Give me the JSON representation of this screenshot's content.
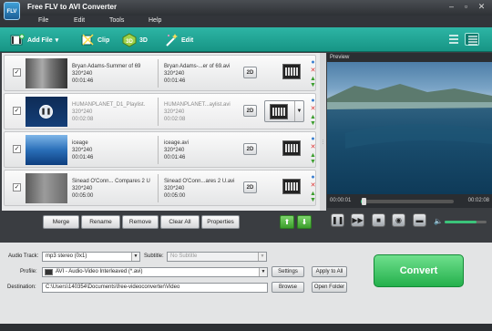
{
  "app": {
    "title": "Free FLV to AVI Converter",
    "logo_text": "FLV"
  },
  "menu": [
    "File",
    "Edit",
    "Tools",
    "Help"
  ],
  "toolbar": {
    "add_file": "Add File",
    "clip": "Clip",
    "3d": "3D",
    "edit": "Edit"
  },
  "files": [
    {
      "name": "Bryan Adams-Summer of 69",
      "res": "320*240",
      "dur": "00:01:46",
      "out_name": "Bryan Adams-...er of 69.avi",
      "out_res": "320*240",
      "out_dur": "00:01:46",
      "mode": "2D"
    },
    {
      "name": "HUMANPLANET_D1_Playlist.",
      "res": "320*240",
      "dur": "00:02:08",
      "out_name": "HUMANPLANET...aylist.avi",
      "out_res": "320*240",
      "out_dur": "00:02:08",
      "mode": "2D"
    },
    {
      "name": "iceage",
      "res": "320*240",
      "dur": "00:01:46",
      "out_name": "iceage.avi",
      "out_res": "320*240",
      "out_dur": "00:01:46",
      "mode": "2D"
    },
    {
      "name": "Sinead O'Conn... Compares 2 U",
      "res": "320*240",
      "dur": "00:05:00",
      "out_name": "Sinead O'Conn...ares 2 U.avi",
      "out_res": "320*240",
      "out_dur": "00:05:00",
      "mode": "2D"
    }
  ],
  "list_buttons": {
    "merge": "Merge",
    "rename": "Rename",
    "remove": "Remove",
    "clear_all": "Clear All",
    "properties": "Properties"
  },
  "preview": {
    "label": "Preview",
    "time_start": "00:00:01",
    "time_end": "00:02:08",
    "progress": 0.03,
    "volume": 0.75
  },
  "settings": {
    "audio_track_label": "Audio Track:",
    "audio_track": "mp3 stereo (0x1)",
    "subtitle_label": "Subtitle:",
    "subtitle": "No Subtitle",
    "profile_label": "Profile:",
    "profile": "AVI - Audio-Video Interleaved (*.avi)",
    "destination_label": "Destination:",
    "destination": "C:\\Users\\140354\\Documents\\free-videoconverter\\Video",
    "settings_btn": "Settings",
    "apply_all_btn": "Apply to All",
    "browse_btn": "Browse",
    "open_folder_btn": "Open Folder"
  },
  "convert_label": "Convert",
  "colors": {
    "toolbar": "#1fa595",
    "convert": "#2dbb55",
    "accent": "#3a8ed0"
  }
}
